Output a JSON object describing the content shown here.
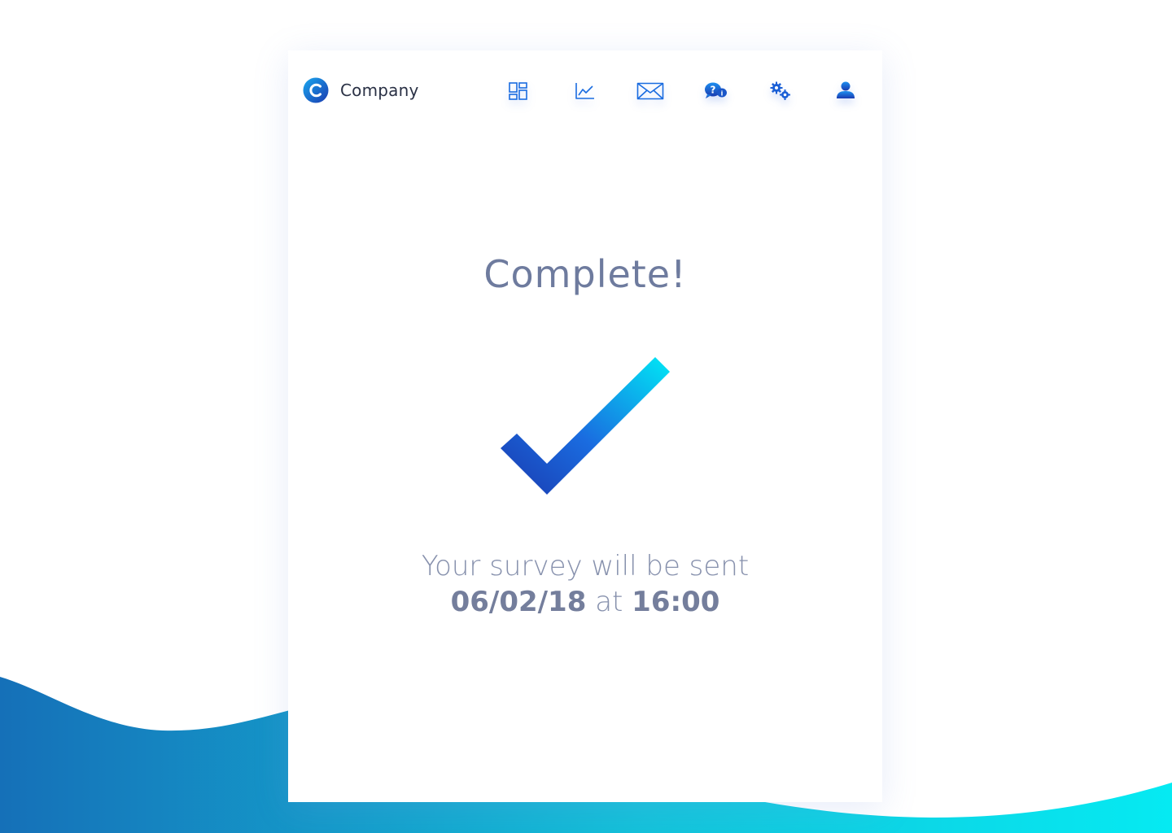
{
  "brand": {
    "name": "Company",
    "logo_icon": "company-logo-icon"
  },
  "nav": {
    "items": [
      {
        "name": "dashboard",
        "icon": "dashboard-icon"
      },
      {
        "name": "analytics",
        "icon": "line-chart-icon"
      },
      {
        "name": "messages",
        "icon": "envelope-icon"
      },
      {
        "name": "help",
        "icon": "help-chat-icon"
      },
      {
        "name": "settings",
        "icon": "gears-icon"
      },
      {
        "name": "profile",
        "icon": "user-icon"
      }
    ]
  },
  "status": {
    "title": "Complete!",
    "check_icon": "checkmark-icon"
  },
  "message": {
    "line1": "Your survey will be sent",
    "date": "06/02/18",
    "connector": "at",
    "time": "16:00"
  },
  "colors": {
    "accent_dark": "#1a3bb0",
    "accent_light": "#00e5f5",
    "text_muted": "#6e7b9e",
    "wave_start": "#1570b8",
    "wave_end": "#05eaf2"
  }
}
